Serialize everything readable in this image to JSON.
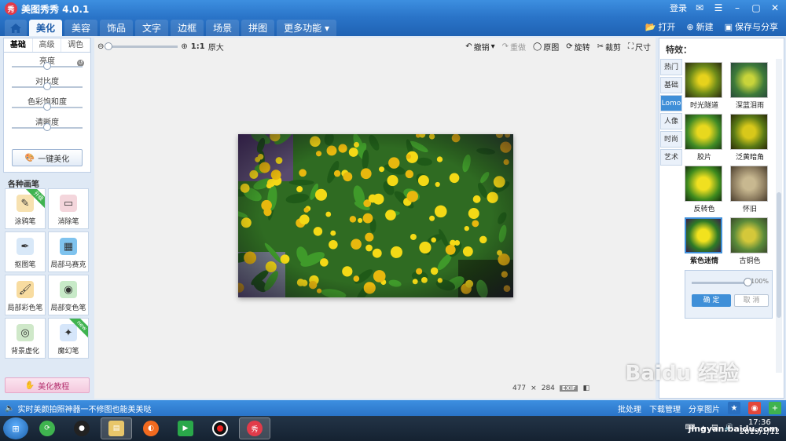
{
  "app": {
    "title": "美图秀秀 4.0.1",
    "logo_text": "秀"
  },
  "title_right": {
    "login": "登录"
  },
  "menu": {
    "tabs": [
      "美化",
      "美容",
      "饰品",
      "文字",
      "边框",
      "场景",
      "拼图"
    ],
    "more": "更多功能",
    "open": "打开",
    "new": "新建",
    "save": "保存与分享"
  },
  "left": {
    "sub_tabs": [
      "基础",
      "高级",
      "调色"
    ],
    "sliders": [
      {
        "label": "亮度",
        "level": 0.5
      },
      {
        "label": "对比度",
        "level": 0.5
      },
      {
        "label": "色彩饱和度",
        "level": 0.5
      },
      {
        "label": "清晰度",
        "level": 0.5
      }
    ],
    "auto_button": "一键美化",
    "brush_title": "各种画笔",
    "brushes": [
      {
        "label": "涂鸦笔",
        "ribbon": "升级"
      },
      {
        "label": "消除笔",
        "ribbon": ""
      },
      {
        "label": "抠图笔",
        "ribbon": ""
      },
      {
        "label": "局部马赛克",
        "ribbon": ""
      },
      {
        "label": "局部彩色笔",
        "ribbon": ""
      },
      {
        "label": "局部变色笔",
        "ribbon": ""
      },
      {
        "label": "背景虚化",
        "ribbon": ""
      },
      {
        "label": "魔幻笔",
        "ribbon": "new"
      }
    ],
    "tutorial": "美化教程"
  },
  "canvas": {
    "ratio": "1:1",
    "original_size": "原大",
    "tools": {
      "undo": "撤销",
      "redo": "重做",
      "original": "原图",
      "rotate": "旋转",
      "crop": "裁剪",
      "size": "尺寸"
    },
    "image_width": "477",
    "image_height": "284",
    "exif": "EXIF"
  },
  "right": {
    "title": "特效：",
    "categories": [
      "热门",
      "基础",
      "Lomo",
      "人像",
      "时尚",
      "艺术"
    ],
    "active_category": "Lomo",
    "effects": [
      "时光隧道",
      "深蓝泪雨",
      "胶片",
      "泛黄暗角",
      "反转色",
      "怀旧",
      "紫色迷情",
      "古铜色"
    ],
    "selected_effect": "紫色迷情",
    "strength": "100%",
    "strength_level": 1.0,
    "ok": "确 定",
    "cancel": "取 消"
  },
  "status": {
    "promo": "实时美颜拍照神器一不修图也能美美哒",
    "batch": "批处理",
    "download": "下载管理",
    "share": "分享图片"
  },
  "taskbar": {
    "time": "17:36",
    "date": "2019/1/12"
  },
  "watermark": {
    "text": "Baidu 经验",
    "url": "jingyan.baidu.com"
  },
  "colors": {
    "accent": "#2a74c8",
    "selected": "#3f8fd8"
  }
}
